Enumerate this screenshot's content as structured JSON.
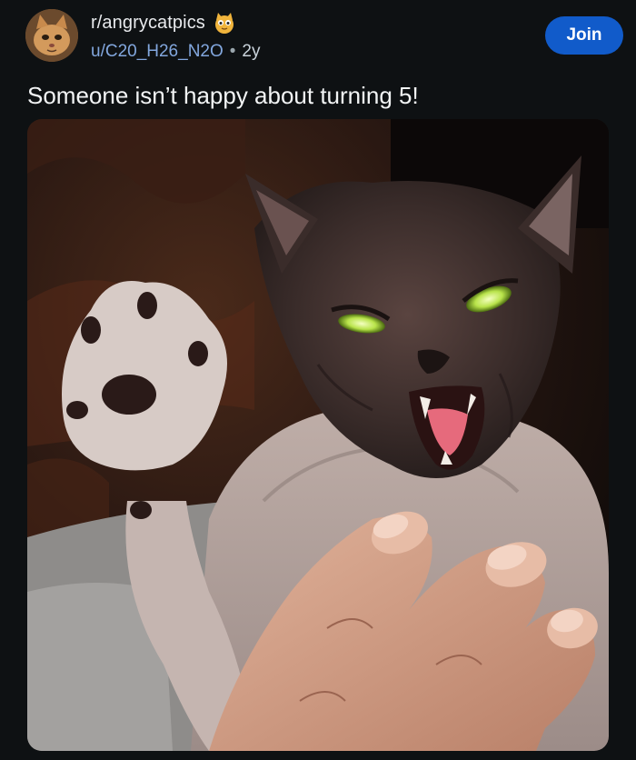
{
  "post": {
    "subreddit": "r/angrycatpics",
    "author": "u/C20_H26_N2O",
    "separator": "•",
    "age": "2y",
    "join_label": "Join",
    "title": "Someone isn’t happy about turning 5!"
  },
  "icons": {
    "avatar": "subreddit-avatar-cat",
    "badge": "cat-face-icon"
  },
  "colors": {
    "background": "#0e1113",
    "join_button": "#115bca",
    "username": "#82a7de"
  }
}
